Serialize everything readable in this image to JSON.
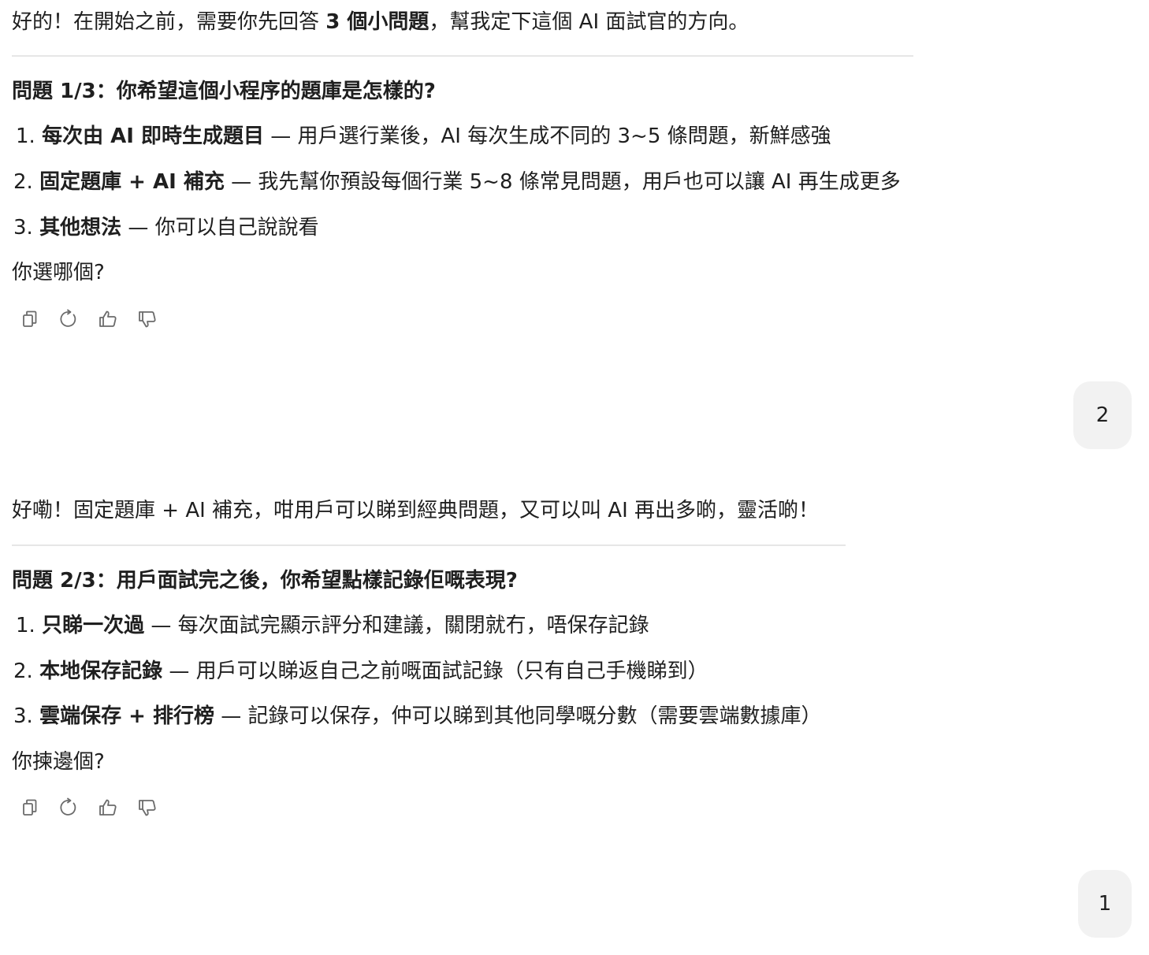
{
  "messages": [
    {
      "intro": {
        "pre": "好的！在開始之前，需要你先回答 ",
        "bold": "3 個小問題",
        "post": "，幫我定下這個 AI 面試官的方向。"
      },
      "question": "問題 1/3：你希望這個小程序的題庫是怎樣的?",
      "options": [
        {
          "num": "1.",
          "title": "每次由 AI 即時生成題目",
          "desc": " — 用戶選行業後，AI 每次生成不同的 3~5 條問題，新鮮感強"
        },
        {
          "num": "2.",
          "title": "固定題庫 + AI 補充",
          "desc": " — 我先幫你預設每個行業 5~8 條常見問題，用戶也可以讓 AI 再生成更多"
        },
        {
          "num": "3.",
          "title": "其他想法",
          "desc": " — 你可以自己說說看"
        }
      ],
      "prompt": "你選哪個?"
    },
    {
      "intro": {
        "pre": "好嘞！固定題庫 + AI 補充，咁用戶可以睇到經典問題，又可以叫 AI 再出多啲，靈活啲！",
        "bold": "",
        "post": ""
      },
      "question": "問題 2/3：用戶面試完之後，你希望點樣記錄佢嘅表現?",
      "options": [
        {
          "num": "1.",
          "title": "只睇一次過",
          "desc": " — 每次面試完顯示評分和建議，關閉就冇，唔保存記錄"
        },
        {
          "num": "2.",
          "title": "本地保存記錄",
          "desc": " — 用戶可以睇返自己之前嘅面試記錄（只有自己手機睇到）"
        },
        {
          "num": "3.",
          "title": "雲端保存 + 排行榜",
          "desc": " — 記錄可以保存，仲可以睇到其他同學嘅分數（需要雲端數據庫）"
        }
      ],
      "prompt": "你揀邊個?"
    }
  ],
  "user_replies": [
    "2",
    "1"
  ],
  "actions": [
    "copy-icon",
    "regenerate-icon",
    "thumbs-up-icon",
    "thumbs-down-icon"
  ]
}
